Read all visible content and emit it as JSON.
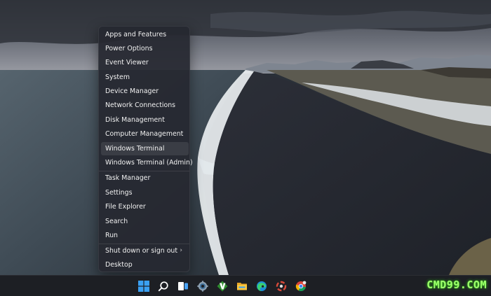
{
  "context_menu": {
    "items": [
      {
        "label": "Apps and Features"
      },
      {
        "label": "Power Options"
      },
      {
        "label": "Event Viewer"
      },
      {
        "label": "System"
      },
      {
        "label": "Device Manager"
      },
      {
        "label": "Network Connections"
      },
      {
        "label": "Disk Management"
      },
      {
        "label": "Computer Management"
      },
      {
        "label": "Windows Terminal",
        "highlighted": true
      },
      {
        "label": "Windows Terminal (Admin)"
      },
      {
        "label": "Task Manager"
      },
      {
        "label": "Settings"
      },
      {
        "label": "File Explorer"
      },
      {
        "label": "Search"
      },
      {
        "label": "Run"
      },
      {
        "label": "Shut down or sign out",
        "has_submenu": true
      },
      {
        "label": "Desktop"
      }
    ],
    "submenu_chevron": "›"
  },
  "taskbar": {
    "icons": [
      "windows-start-icon",
      "search-icon",
      "task-view-icon",
      "settings-gear-icon",
      "vim-icon",
      "file-explorer-icon",
      "edge-browser-icon",
      "media-app-icon",
      "chrome-icon"
    ]
  },
  "watermark": "CMD99.COM",
  "colors": {
    "menu_bg": "#26282f",
    "menu_text": "#f0f0f0",
    "taskbar_bg": "#1d1f24",
    "watermark": "#9dff6c",
    "windows_blue": "#3aa0f3"
  }
}
